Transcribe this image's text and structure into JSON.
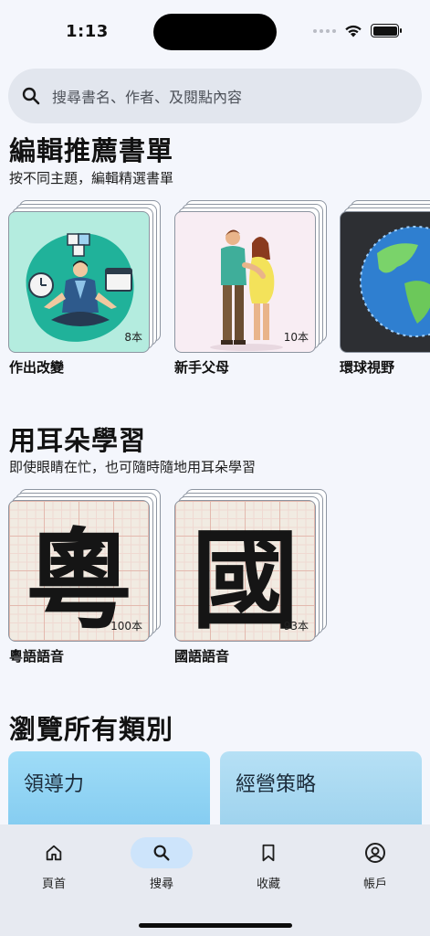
{
  "status_bar": {
    "time": "1:13"
  },
  "search": {
    "placeholder": "搜尋書名、作者、及閱點內容"
  },
  "editor_picks": {
    "title": "編輯推薦書單",
    "subtitle": "按不同主題，編輯精選書單",
    "books": [
      {
        "label": "作出改變",
        "count": "8本",
        "cover_bg": "#b4ecdf"
      },
      {
        "label": "新手父母",
        "count": "10本",
        "cover_bg": "#f8edf3"
      },
      {
        "label": "環球視野",
        "count": "",
        "cover_bg": "#2d2f33"
      }
    ]
  },
  "audio": {
    "title": "用耳朵學習",
    "subtitle": "即使眼睛在忙，也可隨時隨地用耳朵學習",
    "books": [
      {
        "label": "粵語語音",
        "count": "100本",
        "glyph": "粵"
      },
      {
        "label": "國語語音",
        "count": "93本",
        "glyph": "國"
      }
    ]
  },
  "categories": {
    "title": "瀏覽所有類別",
    "items": [
      {
        "label": "領導力",
        "color": "#8fd3f5"
      },
      {
        "label": "經營策略",
        "color": "#a8d9f2"
      }
    ]
  },
  "nav": {
    "items": [
      {
        "label": "頁首",
        "icon": "home-icon"
      },
      {
        "label": "搜尋",
        "icon": "search-icon",
        "active": true
      },
      {
        "label": "收藏",
        "icon": "bookmark-icon"
      },
      {
        "label": "帳戶",
        "icon": "account-icon"
      }
    ]
  }
}
